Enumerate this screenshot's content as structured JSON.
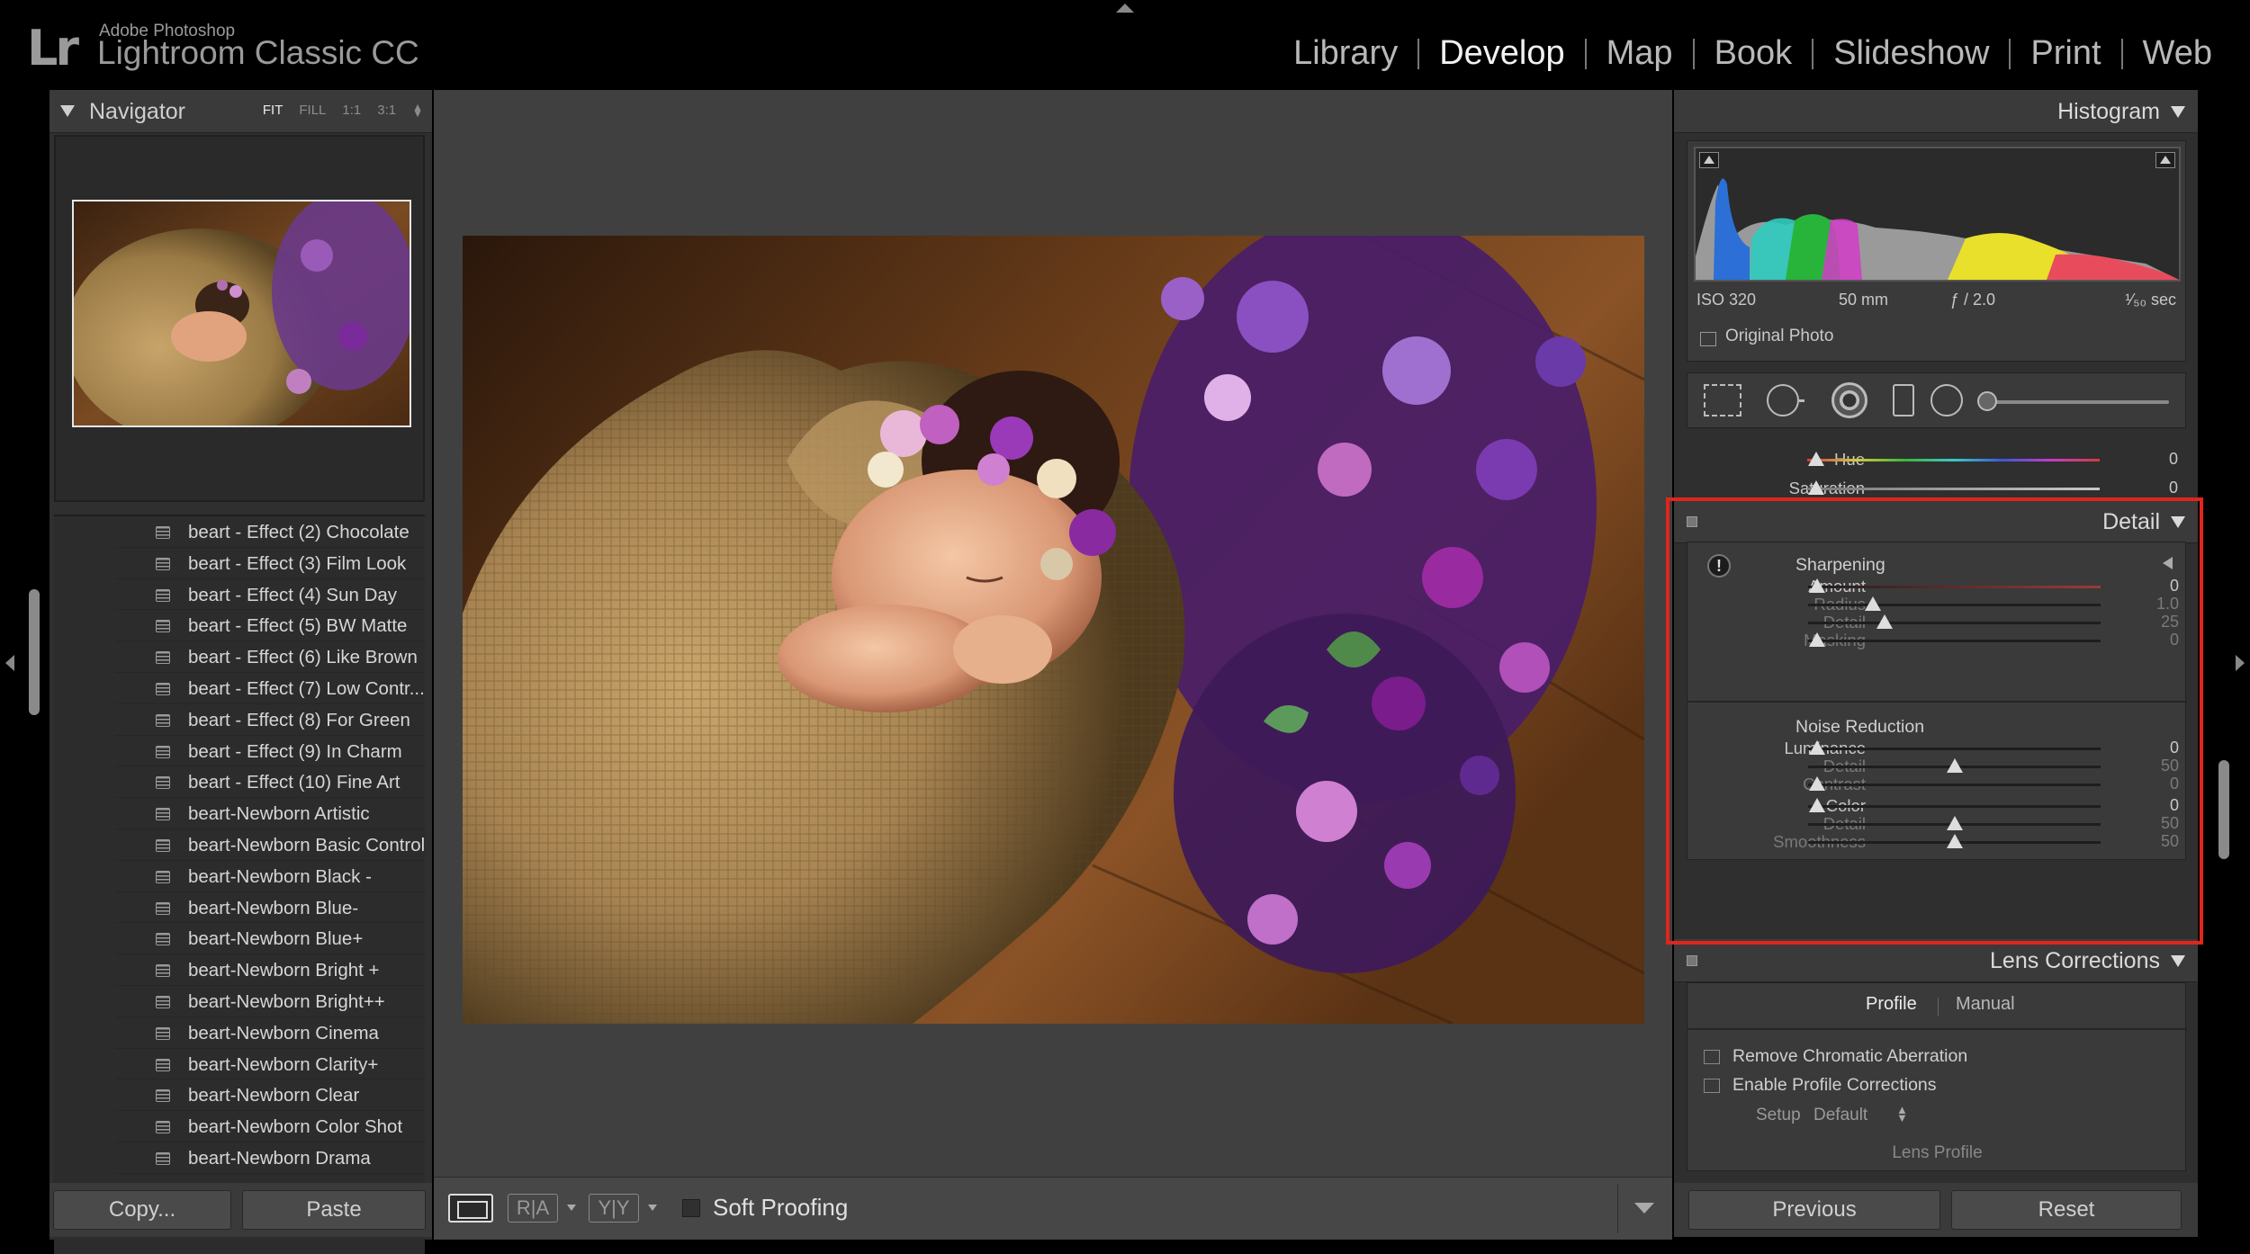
{
  "app": {
    "brand_small": "Adobe Photoshop",
    "brand_big": "Lightroom Classic CC",
    "logo": "Lr"
  },
  "modules": [
    {
      "label": "Library",
      "active": false
    },
    {
      "label": "Develop",
      "active": true
    },
    {
      "label": "Map",
      "active": false
    },
    {
      "label": "Book",
      "active": false
    },
    {
      "label": "Slideshow",
      "active": false
    },
    {
      "label": "Print",
      "active": false
    },
    {
      "label": "Web",
      "active": false
    }
  ],
  "navigator": {
    "title": "Navigator",
    "zoom_options": [
      "FIT",
      "FILL",
      "1:1",
      "3:1"
    ],
    "active_zoom": "FIT"
  },
  "presets": [
    "beart - Effect (2) Chocolate",
    "beart - Effect (3) Film Look",
    "beart - Effect (4) Sun Day",
    "beart - Effect (5) BW Matte",
    "beart - Effect (6) Like Brown",
    "beart - Effect (7) Low Contr...",
    "beart - Effect (8) For Green",
    "beart - Effect (9) In Charm",
    "beart - Effect (10) Fine Art",
    "beart-Newborn Artistic",
    "beart-Newborn Basic Control",
    "beart-Newborn Black -",
    "beart-Newborn Blue-",
    "beart-Newborn Blue+",
    "beart-Newborn Bright +",
    "beart-Newborn Bright++",
    "beart-Newborn Cinema",
    "beart-Newborn Clarity+",
    "beart-Newborn Clear",
    "beart-Newborn Color Shot",
    "beart-Newborn Drama"
  ],
  "left_buttons": {
    "copy": "Copy...",
    "paste": "Paste"
  },
  "toolbar": {
    "ra_label": "R|A",
    "yy_label": "Y|Y",
    "soft_proofing": "Soft Proofing"
  },
  "histogram": {
    "title": "Histogram",
    "iso": "ISO 320",
    "focal": "50 mm",
    "aperture": "ƒ / 2.0",
    "shutter": "¹⁄₅₀ sec",
    "original_photo": "Original Photo"
  },
  "hsl_partial": [
    {
      "label": "Hue",
      "value": "0",
      "level": 0.03
    },
    {
      "label": "Saturation",
      "value": "0",
      "level": 0.03
    }
  ],
  "detail": {
    "title": "Detail",
    "sharpening_title": "Sharpening",
    "sharpening": [
      {
        "label": "Amount",
        "value": "0",
        "level": 0.03,
        "enabled": true
      },
      {
        "label": "Radius",
        "value": "1.0",
        "level": 0.22,
        "enabled": false
      },
      {
        "label": "Detail",
        "value": "25",
        "level": 0.26,
        "enabled": false
      },
      {
        "label": "Masking",
        "value": "0",
        "level": 0.03,
        "enabled": false
      }
    ],
    "noise_title": "Noise Reduction",
    "noise_luminance": [
      {
        "label": "Luminance",
        "value": "0",
        "level": 0.03,
        "enabled": true
      },
      {
        "label": "Detail",
        "value": "50",
        "level": 0.5,
        "enabled": false
      },
      {
        "label": "Contrast",
        "value": "0",
        "level": 0.03,
        "enabled": false
      }
    ],
    "noise_color": [
      {
        "label": "Color",
        "value": "0",
        "level": 0.03,
        "enabled": true
      },
      {
        "label": "Detail",
        "value": "50",
        "level": 0.5,
        "enabled": false
      },
      {
        "label": "Smoothness",
        "value": "50",
        "level": 0.5,
        "enabled": false
      }
    ]
  },
  "lens": {
    "title": "Lens Corrections",
    "tab_profile": "Profile",
    "tab_manual": "Manual",
    "remove_ca": "Remove Chromatic Aberration",
    "enable_profile": "Enable Profile Corrections",
    "setup_label": "Setup",
    "setup_value": "Default",
    "lens_profile": "Lens Profile"
  },
  "right_buttons": {
    "previous": "Previous",
    "reset": "Reset"
  },
  "colors": {
    "highlight_box": "#e0251c",
    "panel_bg": "#2f2f2f",
    "center_bg": "#404040"
  }
}
